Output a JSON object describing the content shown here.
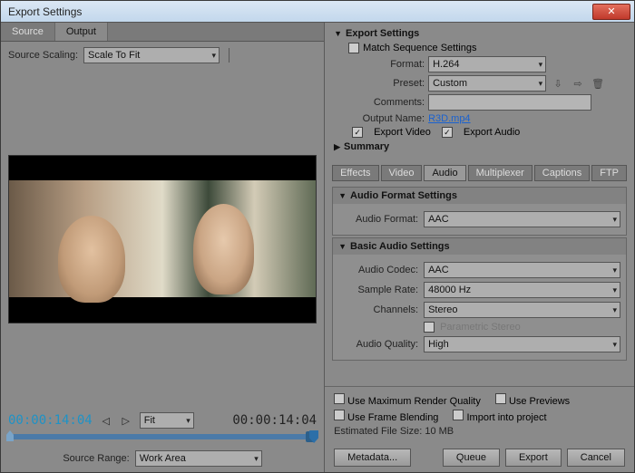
{
  "window": {
    "title": "Export Settings"
  },
  "left": {
    "tabs": {
      "source": "Source",
      "output": "Output"
    },
    "sourceScalingLabel": "Source Scaling:",
    "sourceScalingValue": "Scale To Fit",
    "timecodeLeft": "00:00:14:04",
    "timecodeRight": "00:00:14:04",
    "fitLabel": "Fit",
    "sourceRangeLabel": "Source Range:",
    "sourceRangeValue": "Work Area"
  },
  "export": {
    "title": "Export Settings",
    "matchSeq": "Match Sequence Settings",
    "formatLabel": "Format:",
    "formatValue": "H.264",
    "presetLabel": "Preset:",
    "presetValue": "Custom",
    "commentsLabel": "Comments:",
    "outputNameLabel": "Output Name:",
    "outputNameValue": "R3D.mp4",
    "exportVideo": "Export Video",
    "exportAudio": "Export Audio",
    "summary": "Summary"
  },
  "miniTabs": {
    "effects": "Effects",
    "video": "Video",
    "audio": "Audio",
    "multiplexer": "Multiplexer",
    "captions": "Captions",
    "ftp": "FTP"
  },
  "audioFmt": {
    "title": "Audio Format Settings",
    "audioFormatLabel": "Audio Format:",
    "audioFormatValue": "AAC"
  },
  "basicAudio": {
    "title": "Basic Audio Settings",
    "codecLabel": "Audio Codec:",
    "codecValue": "AAC",
    "srLabel": "Sample Rate:",
    "srValue": "48000 Hz",
    "chLabel": "Channels:",
    "chValue": "Stereo",
    "paramStereo": "Parametric Stereo",
    "qualLabel": "Audio Quality:",
    "qualValue": "High"
  },
  "bottom": {
    "maxQuality": "Use Maximum Render Quality",
    "usePreviews": "Use Previews",
    "frameBlend": "Use Frame Blending",
    "importProj": "Import into project",
    "estSize": "Estimated File Size:  10 MB",
    "metadata": "Metadata...",
    "queue": "Queue",
    "export": "Export",
    "cancel": "Cancel"
  }
}
